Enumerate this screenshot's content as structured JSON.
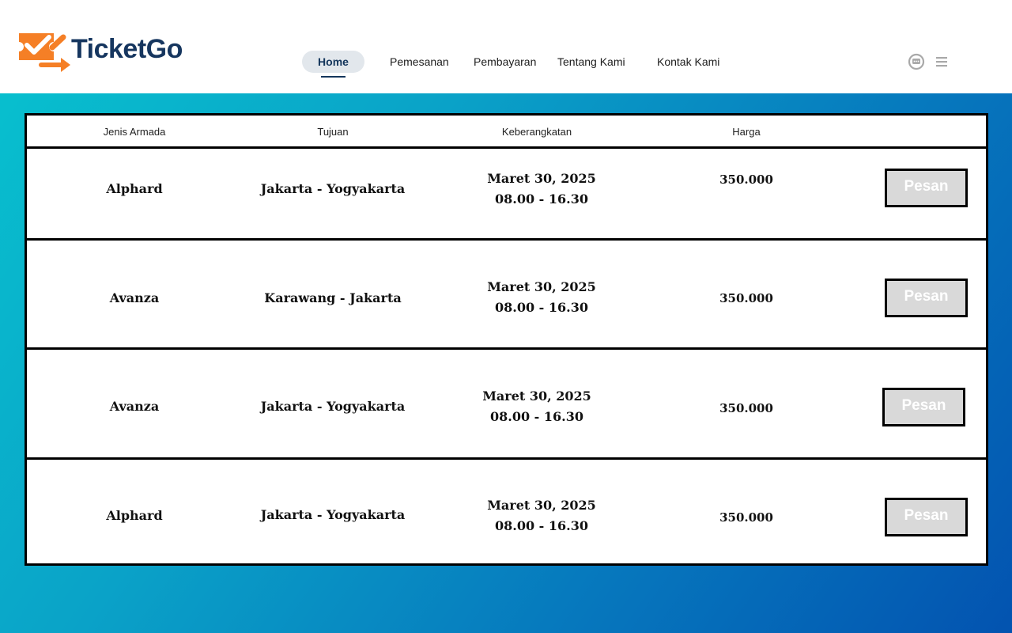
{
  "brand": {
    "name": "TicketGo",
    "colors": {
      "orange": "#f57f26",
      "navy": "#16365f"
    }
  },
  "nav": {
    "items": [
      "Home",
      "Pemesanan",
      "Pembayaran",
      "Tentang Kami",
      "Kontak Kami"
    ],
    "active": "Home"
  },
  "header_icons": [
    "chat-icon",
    "menu-icon"
  ],
  "table": {
    "headers": [
      "Jenis Armada",
      "Tujuan",
      "Keberangkatan",
      "Harga"
    ],
    "rows": [
      {
        "armada": "Alphard",
        "tujuan": "Jakarta - Yogyakarta",
        "tanggal": "Maret 30, 2025",
        "jam": "08.00 - 16.30",
        "harga": "350.000",
        "button": "Pesan"
      },
      {
        "armada": "Avanza",
        "tujuan": "Karawang - Jakarta",
        "tanggal": "Maret 30, 2025",
        "jam": "08.00 - 16.30",
        "harga": "350.000",
        "button": "Pesan"
      },
      {
        "armada": "Avanza",
        "tujuan": "Jakarta - Yogyakarta",
        "tanggal": "Maret 30, 2025",
        "jam": "08.00 - 16.30",
        "harga": "350.000",
        "button": "Pesan"
      },
      {
        "armada": "Alphard",
        "tujuan": "Jakarta - Yogyakarta",
        "tanggal": "Maret 30, 2025",
        "jam": "08.00 - 16.30",
        "harga": "350.000",
        "button": "Pesan"
      }
    ]
  }
}
